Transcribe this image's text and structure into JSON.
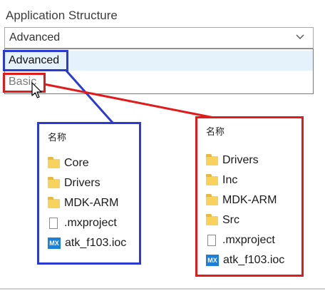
{
  "app_structure": {
    "label": "Application Structure",
    "selected_value": "Advanced",
    "options": [
      "Advanced",
      "Basic"
    ]
  },
  "panels": {
    "advanced": {
      "header": "名称",
      "entries": [
        {
          "name": "Core",
          "icon": "folder-icon"
        },
        {
          "name": "Drivers",
          "icon": "folder-icon"
        },
        {
          "name": "MDK-ARM",
          "icon": "folder-icon"
        },
        {
          "name": ".mxproject",
          "icon": "file-icon"
        },
        {
          "name": "atk_f103.ioc",
          "icon": "mx-icon"
        }
      ]
    },
    "basic": {
      "header": "名称",
      "entries": [
        {
          "name": "Drivers",
          "icon": "folder-icon"
        },
        {
          "name": "Inc",
          "icon": "folder-icon"
        },
        {
          "name": "MDK-ARM",
          "icon": "folder-icon"
        },
        {
          "name": "Src",
          "icon": "folder-icon"
        },
        {
          "name": ".mxproject",
          "icon": "file-icon"
        },
        {
          "name": "atk_f103.ioc",
          "icon": "mx-icon"
        }
      ]
    }
  },
  "icons": {
    "mx_label": "MX"
  },
  "colors": {
    "advanced_highlight": "#2b3bd1",
    "basic_highlight": "#e01b1b",
    "folder": "#f7d35e",
    "mx_badge": "#1e7fd6",
    "hover_option": "#e5f1fb"
  }
}
